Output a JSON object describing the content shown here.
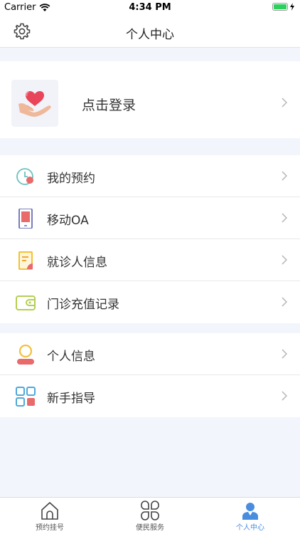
{
  "status_bar": {
    "carrier": "Carrier",
    "time": "4:34 PM"
  },
  "nav": {
    "title": "个人中心"
  },
  "login": {
    "label": "点击登录"
  },
  "menu_group_1": [
    {
      "label": "我的预约",
      "icon": "clock-icon"
    },
    {
      "label": "移动OA",
      "icon": "phone-icon"
    },
    {
      "label": "就诊人信息",
      "icon": "document-icon"
    },
    {
      "label": "门诊充值记录",
      "icon": "wallet-icon"
    }
  ],
  "menu_group_2": [
    {
      "label": "个人信息",
      "icon": "person-icon"
    },
    {
      "label": "新手指导",
      "icon": "grid-icon"
    }
  ],
  "tabs": [
    {
      "label": "预约挂号",
      "icon": "home-icon",
      "active": false
    },
    {
      "label": "便民服务",
      "icon": "clover-icon",
      "active": false
    },
    {
      "label": "个人中心",
      "icon": "user-icon",
      "active": true
    }
  ],
  "colors": {
    "accent": "#4a8de0",
    "background": "#f2f5fb"
  }
}
